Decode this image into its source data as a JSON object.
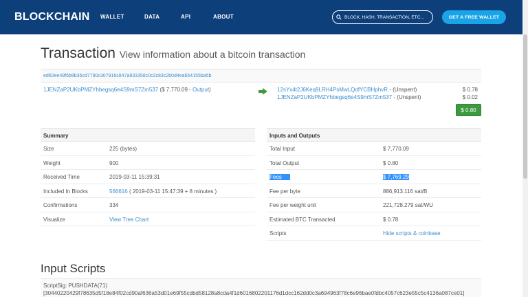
{
  "header": {
    "brand": "BLOCKCHAIN",
    "nav": [
      "WALLET",
      "DATA",
      "API",
      "ABOUT"
    ],
    "search_placeholder": "BLOCK, HASH, TRANSACTION, ETC...",
    "cta_label": "GET A FREE WALLET"
  },
  "title": {
    "main": "Transaction",
    "sub": "View information about a bitcoin transaction"
  },
  "tx_hash": "ed60ee49f6b8b35cd7790c307916c847a933358c0c2c83c2b0d4ea654155ba5b",
  "inputs": [
    {
      "address": "1JENZaP2UKbPMZYhbegsq6e4S9mS7Zm537",
      "value": "$ 7,770.09",
      "label": "Output"
    }
  ],
  "outputs": [
    {
      "address": "12sYx4t2J6Keq9LRH4PsMwLQdfYCBHphvR",
      "status": "Unspent",
      "amount": "$ 0.78"
    },
    {
      "address": "1JENZaP2UKbPMZYhbegsq6e4S9mS7Zm537",
      "status": "Unspent",
      "amount": "$ 0.02"
    }
  ],
  "total_badge": "$ 0.80",
  "summary": {
    "heading": "Summary",
    "size_label": "Size",
    "size_value": "225 (bytes)",
    "weight_label": "Weight",
    "weight_value": "900",
    "received_label": "Received Time",
    "received_value": "2019-03-11 15:39:31",
    "block_label": "Included In Blocks",
    "block_link": "566616",
    "block_detail": "( 2019-03-11 15:47:39 + 8 minutes )",
    "confirm_label": "Confirmations",
    "confirm_value": "334",
    "visualize_label": "Visualize",
    "visualize_link": "View Tree Chart"
  },
  "io_panel": {
    "heading": "Inputs and Outputs",
    "total_input_label": "Total Input",
    "total_input_value": "$ 7,770.09",
    "total_output_label": "Total Output",
    "total_output_value": "$ 0.80",
    "fees_label": "Fees",
    "fees_value": "$ 7,769.29",
    "fee_byte_label": "Fee per byte",
    "fee_byte_value": "886,913.116 sat/B",
    "fee_weight_label": "Fee per weight unit",
    "fee_weight_value": "221,728.279 sat/WU",
    "est_label": "Estimated BTC Transacted",
    "est_value": "$ 0.78",
    "scripts_label": "Scripts",
    "scripts_link": "Hide scripts & coinbase"
  },
  "input_scripts": {
    "heading": "Input Scripts",
    "line1": "ScriptSig: PUSHDATA(71)",
    "line2": "[30440220429f78635d5f18e84f02cd90af636a53d01e69f55cdbd58128a8cda4f1d6016802201176d1dcc162dd0c3a694963f78c6e96bae0fdbc4057c623e55c5c4136a087ce01]"
  },
  "colors": {
    "nav": "#0d3f7a",
    "accent": "#1aa3e6",
    "link": "#3a8ecf",
    "success": "#3e9a3e"
  }
}
